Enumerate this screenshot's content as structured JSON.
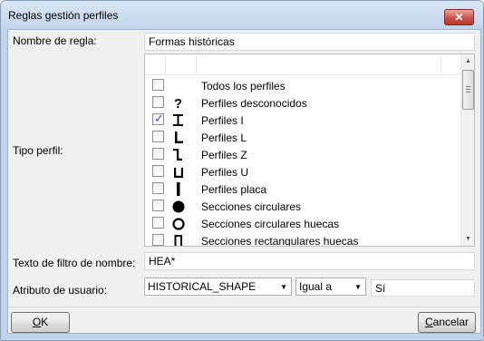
{
  "window": {
    "title": "Reglas gestión perfiles",
    "close_glyph": "✕"
  },
  "form": {
    "rule_name_label": "Nombre de regla:",
    "rule_name_value": "Formas históricas",
    "profile_type_label": "Tipo perfil:",
    "name_filter_label": "Texto de filtro de nombre:",
    "name_filter_value": "HEA*",
    "user_attr_label": "Atributo de usuario:",
    "user_attr_combo": "HISTORICAL_SHAPE",
    "operator_combo": "Igual a",
    "user_attr_value": "Sí"
  },
  "profile_list": [
    {
      "label": "Todos los perfiles",
      "checked": false,
      "icon": "none"
    },
    {
      "label": "Perfiles desconocidos",
      "checked": false,
      "icon": "question-icon"
    },
    {
      "label": "Perfiles I",
      "checked": true,
      "icon": "i-profile-icon"
    },
    {
      "label": "Perfiles L",
      "checked": false,
      "icon": "l-profile-icon"
    },
    {
      "label": "Perfiles Z",
      "checked": false,
      "icon": "z-profile-icon"
    },
    {
      "label": "Perfiles U",
      "checked": false,
      "icon": "u-profile-icon"
    },
    {
      "label": "Perfiles placa",
      "checked": false,
      "icon": "plate-profile-icon"
    },
    {
      "label": "Secciones circulares",
      "checked": false,
      "icon": "filled-circle-icon"
    },
    {
      "label": "Secciones circulares huecas",
      "checked": false,
      "icon": "hollow-circle-icon"
    },
    {
      "label": "Secciones rectangulares huecas",
      "checked": false,
      "icon": "hollow-rectangle-icon"
    }
  ],
  "buttons": {
    "ok_underline": "O",
    "ok_rest": "K",
    "cancel_underline": "C",
    "cancel_rest": "ancelar"
  }
}
